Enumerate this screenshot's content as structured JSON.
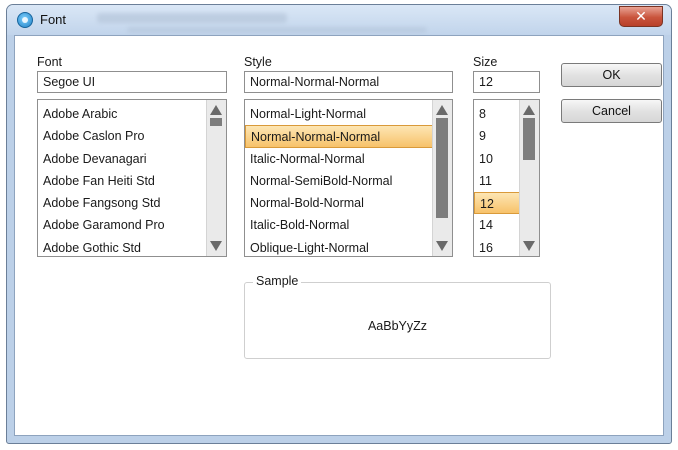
{
  "window": {
    "title": "Font",
    "close_glyph": "✕"
  },
  "font": {
    "label": "Font",
    "value": "Segoe UI",
    "items": [
      "Adobe Arabic",
      "Adobe Caslon Pro",
      "Adobe Devanagari",
      "Adobe Fan Heiti Std",
      "Adobe Fangsong Std",
      "Adobe Garamond Pro",
      "Adobe Gothic Std"
    ]
  },
  "style": {
    "label": "Style",
    "value": "Normal-Normal-Normal",
    "items": [
      "Normal-Light-Normal",
      "Normal-Normal-Normal",
      "Italic-Normal-Normal",
      "Normal-SemiBold-Normal",
      "Normal-Bold-Normal",
      "Italic-Bold-Normal",
      "Oblique-Light-Normal"
    ],
    "selected_index": 1
  },
  "size": {
    "label": "Size",
    "value": "12",
    "items": [
      "8",
      "9",
      "10",
      "11",
      "12",
      "14",
      "16"
    ],
    "selected_index": 4
  },
  "buttons": {
    "ok": "OK",
    "cancel": "Cancel"
  },
  "sample": {
    "legend": "Sample",
    "text": "AaBbYyZz"
  },
  "icons": {
    "app": "font-app-icon",
    "close": "close-icon",
    "scroll_up": "arrow-up-icon",
    "scroll_down": "arrow-down-icon"
  },
  "colors": {
    "selection": "#f7c26a",
    "title_bar": "#c1d4eb",
    "close_button": "#c9543c"
  }
}
